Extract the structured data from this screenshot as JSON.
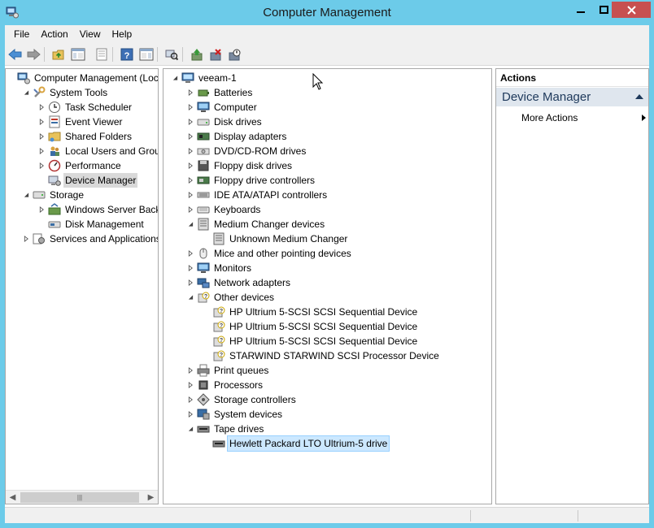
{
  "window": {
    "title": "Computer Management"
  },
  "menu": [
    "File",
    "Action",
    "View",
    "Help"
  ],
  "toolbar_icons": [
    "back-icon",
    "forward-icon",
    "up-folder-icon",
    "show-hide-console-tree-icon",
    "properties-icon",
    "help-icon",
    "show-hide-action-pane-icon",
    "scan-hardware-icon",
    "update-driver-icon",
    "uninstall-icon",
    "disable-device-icon"
  ],
  "left_tree": [
    {
      "label": "Computer Management (Local",
      "icon": "computer-management-icon",
      "level": 0,
      "expander": "none"
    },
    {
      "label": "System Tools",
      "icon": "tools-icon",
      "level": 1,
      "expander": "expanded"
    },
    {
      "label": "Task Scheduler",
      "icon": "clock-icon",
      "level": 2,
      "expander": "collapsed"
    },
    {
      "label": "Event Viewer",
      "icon": "event-viewer-icon",
      "level": 2,
      "expander": "collapsed"
    },
    {
      "label": "Shared Folders",
      "icon": "shared-folder-icon",
      "level": 2,
      "expander": "collapsed"
    },
    {
      "label": "Local Users and Groups",
      "icon": "users-icon",
      "level": 2,
      "expander": "collapsed"
    },
    {
      "label": "Performance",
      "icon": "performance-icon",
      "level": 2,
      "expander": "collapsed"
    },
    {
      "label": "Device Manager",
      "icon": "device-manager-icon",
      "level": 2,
      "expander": "none",
      "selected": true
    },
    {
      "label": "Storage",
      "icon": "storage-icon",
      "level": 1,
      "expander": "expanded"
    },
    {
      "label": "Windows Server Backup",
      "icon": "backup-icon",
      "level": 2,
      "expander": "collapsed"
    },
    {
      "label": "Disk Management",
      "icon": "disk-management-icon",
      "level": 2,
      "expander": "none"
    },
    {
      "label": "Services and Applications",
      "icon": "services-icon",
      "level": 1,
      "expander": "collapsed"
    }
  ],
  "device_tree": [
    {
      "label": "veeam-1",
      "icon": "computer-icon",
      "level": 0,
      "expander": "expanded"
    },
    {
      "label": "Batteries",
      "icon": "battery-icon",
      "level": 1,
      "expander": "collapsed"
    },
    {
      "label": "Computer",
      "icon": "monitor-icon",
      "level": 1,
      "expander": "collapsed"
    },
    {
      "label": "Disk drives",
      "icon": "disk-drive-icon",
      "level": 1,
      "expander": "collapsed"
    },
    {
      "label": "Display adapters",
      "icon": "display-adapter-icon",
      "level": 1,
      "expander": "collapsed"
    },
    {
      "label": "DVD/CD-ROM drives",
      "icon": "dvd-drive-icon",
      "level": 1,
      "expander": "collapsed"
    },
    {
      "label": "Floppy disk drives",
      "icon": "floppy-icon",
      "level": 1,
      "expander": "collapsed"
    },
    {
      "label": "Floppy drive controllers",
      "icon": "floppy-controller-icon",
      "level": 1,
      "expander": "collapsed"
    },
    {
      "label": "IDE ATA/ATAPI controllers",
      "icon": "ide-controller-icon",
      "level": 1,
      "expander": "collapsed"
    },
    {
      "label": "Keyboards",
      "icon": "keyboard-icon",
      "level": 1,
      "expander": "collapsed"
    },
    {
      "label": "Medium Changer devices",
      "icon": "medium-changer-icon",
      "level": 1,
      "expander": "expanded"
    },
    {
      "label": "Unknown Medium Changer",
      "icon": "medium-changer-icon",
      "level": 2,
      "expander": "none"
    },
    {
      "label": "Mice and other pointing devices",
      "icon": "mouse-icon",
      "level": 1,
      "expander": "collapsed"
    },
    {
      "label": "Monitors",
      "icon": "monitor-icon",
      "level": 1,
      "expander": "collapsed"
    },
    {
      "label": "Network adapters",
      "icon": "network-adapter-icon",
      "level": 1,
      "expander": "collapsed"
    },
    {
      "label": "Other devices",
      "icon": "unknown-device-icon",
      "level": 1,
      "expander": "expanded"
    },
    {
      "label": "HP Ultrium 5-SCSI SCSI Sequential Device",
      "icon": "unknown-device-icon",
      "level": 2,
      "expander": "none"
    },
    {
      "label": "HP Ultrium 5-SCSI SCSI Sequential Device",
      "icon": "unknown-device-icon",
      "level": 2,
      "expander": "none"
    },
    {
      "label": "HP Ultrium 5-SCSI SCSI Sequential Device",
      "icon": "unknown-device-icon",
      "level": 2,
      "expander": "none"
    },
    {
      "label": "STARWIND STARWIND SCSI Processor Device",
      "icon": "unknown-device-icon",
      "level": 2,
      "expander": "none"
    },
    {
      "label": "Print queues",
      "icon": "printer-icon",
      "level": 1,
      "expander": "collapsed"
    },
    {
      "label": "Processors",
      "icon": "processor-icon",
      "level": 1,
      "expander": "collapsed"
    },
    {
      "label": "Storage controllers",
      "icon": "storage-controller-icon",
      "level": 1,
      "expander": "collapsed"
    },
    {
      "label": "System devices",
      "icon": "system-device-icon",
      "level": 1,
      "expander": "collapsed"
    },
    {
      "label": "Tape drives",
      "icon": "tape-drive-icon",
      "level": 1,
      "expander": "expanded"
    },
    {
      "label": "Hewlett Packard LTO Ultrium-5 drive",
      "icon": "tape-drive-icon",
      "level": 2,
      "expander": "none",
      "selected": true
    }
  ],
  "actions": {
    "header": "Actions",
    "section": "Device Manager",
    "items": [
      "More Actions"
    ]
  },
  "colors": {
    "titlebar": "#6ccbe9",
    "close_button": "#c75050",
    "selection": "#cce8ff"
  }
}
